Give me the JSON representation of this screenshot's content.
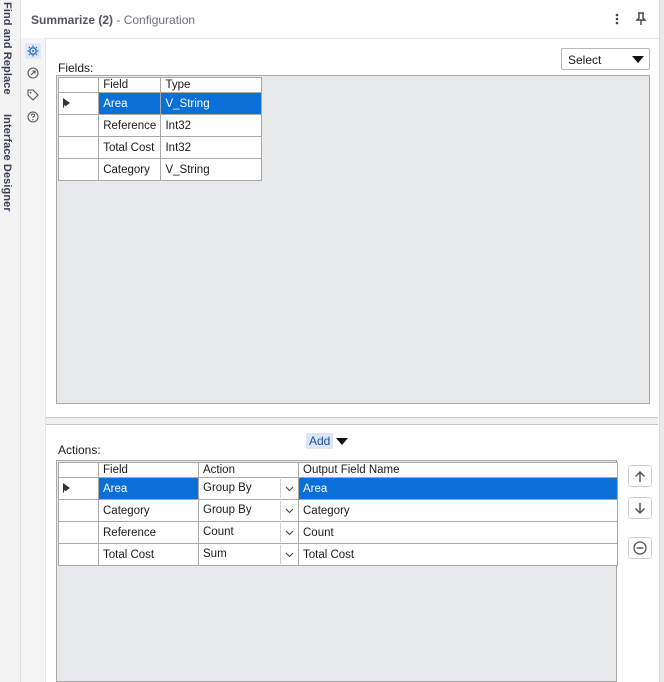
{
  "side_tabs": {
    "find_replace": "Find and Replace",
    "interface_designer": "Interface Designer"
  },
  "header": {
    "tool_name": "Summarize (2)",
    "subtitle": " - Configuration"
  },
  "fields": {
    "label": "Fields:",
    "select_value": "Select",
    "columns": [
      "Field",
      "Type"
    ],
    "rows": [
      {
        "field": "Area",
        "type": "V_String",
        "selected": true
      },
      {
        "field": "Reference",
        "type": "Int32",
        "selected": false
      },
      {
        "field": "Total Cost",
        "type": "Int32",
        "selected": false
      },
      {
        "field": "Category",
        "type": "V_String",
        "selected": false
      }
    ]
  },
  "actions": {
    "label": "Actions:",
    "add_label": "Add",
    "columns": [
      "Field",
      "Action",
      "Output Field Name"
    ],
    "rows": [
      {
        "field": "Area",
        "action": "Group By",
        "output": "Area",
        "selected": true
      },
      {
        "field": "Category",
        "action": "Group By",
        "output": "Category",
        "selected": false
      },
      {
        "field": "Reference",
        "action": "Count",
        "output": "Count",
        "selected": false
      },
      {
        "field": "Total Cost",
        "action": "Sum",
        "output": "Total Cost",
        "selected": false
      }
    ]
  },
  "icons": {
    "settings": "gear-icon",
    "annotation": "annotation-icon",
    "tag": "tag-icon",
    "help": "help-icon",
    "more": "more-vertical-icon",
    "pin": "pin-icon",
    "move_up": "arrow-up-icon",
    "move_down": "arrow-down-icon",
    "remove": "minus-circle-icon"
  },
  "colors": {
    "selection": "#0a6fd6",
    "panel_bg": "#e8e9eb",
    "accent": "#2f6fc0"
  }
}
